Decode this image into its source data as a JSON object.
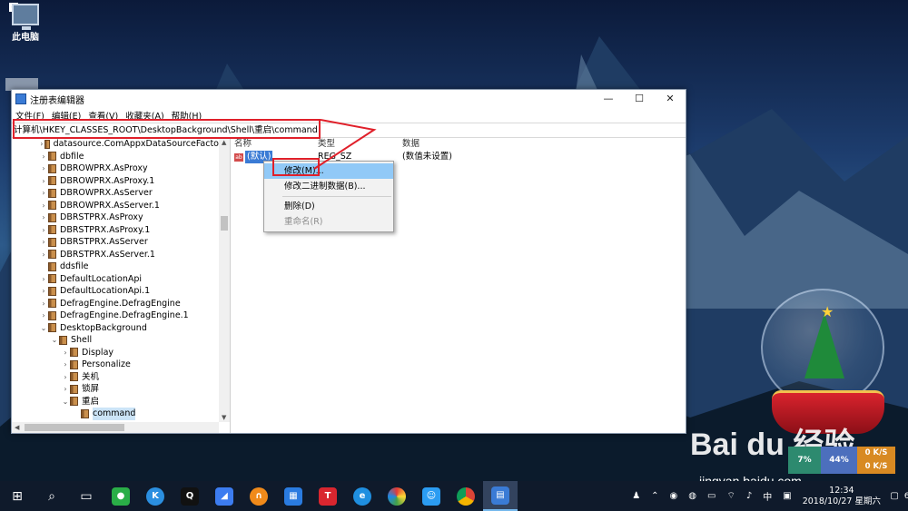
{
  "desktop": {
    "icon_label": "此电脑"
  },
  "window": {
    "title": "注册表编辑器",
    "controls": {
      "minimize": "—",
      "maximize": "☐",
      "close": "✕"
    }
  },
  "menu": [
    "文件(F)",
    "编辑(E)",
    "查看(V)",
    "收藏夹(A)",
    "帮助(H)"
  ],
  "address": "计算机\\HKEY_CLASSES_ROOT\\DesktopBackground\\Shell\\重启\\command",
  "tree": [
    {
      "label": "datasource.ComAppxDataSourceFacto",
      "indent": 0,
      "expand": "›"
    },
    {
      "label": "dbfile",
      "indent": 0,
      "expand": "›"
    },
    {
      "label": "DBROWPRX.AsProxy",
      "indent": 0,
      "expand": "›"
    },
    {
      "label": "DBROWPRX.AsProxy.1",
      "indent": 0,
      "expand": "›"
    },
    {
      "label": "DBROWPRX.AsServer",
      "indent": 0,
      "expand": "›"
    },
    {
      "label": "DBROWPRX.AsServer.1",
      "indent": 0,
      "expand": "›"
    },
    {
      "label": "DBRSTPRX.AsProxy",
      "indent": 0,
      "expand": "›"
    },
    {
      "label": "DBRSTPRX.AsProxy.1",
      "indent": 0,
      "expand": "›"
    },
    {
      "label": "DBRSTPRX.AsServer",
      "indent": 0,
      "expand": "›"
    },
    {
      "label": "DBRSTPRX.AsServer.1",
      "indent": 0,
      "expand": "›"
    },
    {
      "label": "ddsfile",
      "indent": 0,
      "expand": ""
    },
    {
      "label": "DefaultLocationApi",
      "indent": 0,
      "expand": "›"
    },
    {
      "label": "DefaultLocationApi.1",
      "indent": 0,
      "expand": "›"
    },
    {
      "label": "DefragEngine.DefragEngine",
      "indent": 0,
      "expand": "›"
    },
    {
      "label": "DefragEngine.DefragEngine.1",
      "indent": 0,
      "expand": "›"
    },
    {
      "label": "DesktopBackground",
      "indent": 0,
      "expand": "⌄"
    },
    {
      "label": "Shell",
      "indent": 1,
      "expand": "⌄"
    },
    {
      "label": "Display",
      "indent": 2,
      "expand": "›"
    },
    {
      "label": "Personalize",
      "indent": 2,
      "expand": "›"
    },
    {
      "label": "关机",
      "indent": 2,
      "expand": "›"
    },
    {
      "label": "锁屏",
      "indent": 2,
      "expand": "›"
    },
    {
      "label": "重启",
      "indent": 2,
      "expand": "⌄"
    },
    {
      "label": "command",
      "indent": 3,
      "expand": "",
      "selected": true
    }
  ],
  "columns": {
    "name": "名称",
    "type": "类型",
    "data": "数据"
  },
  "values": [
    {
      "name": "(默认)",
      "type": "REG_SZ",
      "data": "(数值未设置)",
      "icon": "ab"
    }
  ],
  "context_menu": {
    "items": [
      "修改(M)...",
      "修改二进制数据(B)...",
      "删除(D)",
      "重命名(R)"
    ]
  },
  "watermark": {
    "text": "Bai du 经验",
    "sub": "jingyan.baidu.com"
  },
  "netspeed": {
    "a": "7%",
    "b": "44%",
    "up": "0 K/S",
    "down": "0 K/S"
  },
  "taskbar": {
    "tray_ime": "中",
    "time": "12:34",
    "date": "2018/10/27 星期六",
    "notif_count": "6"
  }
}
